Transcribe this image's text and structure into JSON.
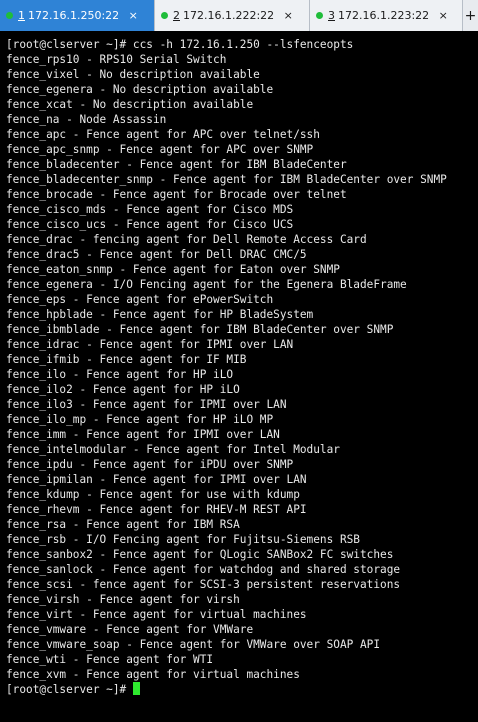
{
  "colors": {
    "active_tab_bg": "#2f83d6",
    "tab_status_dot": "#1fbd3a",
    "terminal_bg": "#000000",
    "terminal_fg": "#e9e9e9",
    "cursor": "#2ee82e"
  },
  "tabs": [
    {
      "number": "1",
      "label": "172.16.1.250:22",
      "active": true,
      "icon": "status-dot-icon",
      "close_icon": "close-icon",
      "close_glyph": "×"
    },
    {
      "number": "2",
      "label": "172.16.1.222:22",
      "active": false,
      "icon": "status-dot-icon",
      "close_icon": "close-icon",
      "close_glyph": "×"
    },
    {
      "number": "3",
      "label": "172.16.1.223:22",
      "active": false,
      "icon": "status-dot-icon",
      "close_icon": "close-icon",
      "close_glyph": "×"
    }
  ],
  "new_tab": {
    "icon": "plus-icon",
    "glyph": "+"
  },
  "terminal": {
    "lines": [
      "[root@clserver ~]# ccs -h 172.16.1.250 --lsfenceopts",
      "fence_rps10 - RPS10 Serial Switch",
      "fence_vixel - No description available",
      "fence_egenera - No description available",
      "fence_xcat - No description available",
      "fence_na - Node Assassin",
      "fence_apc - Fence agent for APC over telnet/ssh",
      "fence_apc_snmp - Fence agent for APC over SNMP",
      "fence_bladecenter - Fence agent for IBM BladeCenter",
      "fence_bladecenter_snmp - Fence agent for IBM BladeCenter over SNMP",
      "fence_brocade - Fence agent for Brocade over telnet",
      "fence_cisco_mds - Fence agent for Cisco MDS",
      "fence_cisco_ucs - Fence agent for Cisco UCS",
      "fence_drac - fencing agent for Dell Remote Access Card",
      "fence_drac5 - Fence agent for Dell DRAC CMC/5",
      "fence_eaton_snmp - Fence agent for Eaton over SNMP",
      "fence_egenera - I/O Fencing agent for the Egenera BladeFrame",
      "fence_eps - Fence agent for ePowerSwitch",
      "fence_hpblade - Fence agent for HP BladeSystem",
      "fence_ibmblade - Fence agent for IBM BladeCenter over SNMP",
      "fence_idrac - Fence agent for IPMI over LAN",
      "fence_ifmib - Fence agent for IF MIB",
      "fence_ilo - Fence agent for HP iLO",
      "fence_ilo2 - Fence agent for HP iLO",
      "fence_ilo3 - Fence agent for IPMI over LAN",
      "fence_ilo_mp - Fence agent for HP iLO MP",
      "fence_imm - Fence agent for IPMI over LAN",
      "fence_intelmodular - Fence agent for Intel Modular",
      "fence_ipdu - Fence agent for iPDU over SNMP",
      "fence_ipmilan - Fence agent for IPMI over LAN",
      "fence_kdump - Fence agent for use with kdump",
      "fence_rhevm - Fence agent for RHEV-M REST API",
      "fence_rsa - Fence agent for IBM RSA",
      "fence_rsb - I/O Fencing agent for Fujitsu-Siemens RSB",
      "fence_sanbox2 - Fence agent for QLogic SANBox2 FC switches",
      "fence_sanlock - Fence agent for watchdog and shared storage",
      "fence_scsi - fence agent for SCSI-3 persistent reservations",
      "fence_virsh - Fence agent for virsh",
      "fence_virt - Fence agent for virtual machines",
      "fence_vmware - Fence agent for VMWare",
      "fence_vmware_soap - Fence agent for VMWare over SOAP API",
      "fence_wti - Fence agent for WTI",
      "fence_xvm - Fence agent for virtual machines"
    ],
    "prompt": "[root@clserver ~]# "
  }
}
